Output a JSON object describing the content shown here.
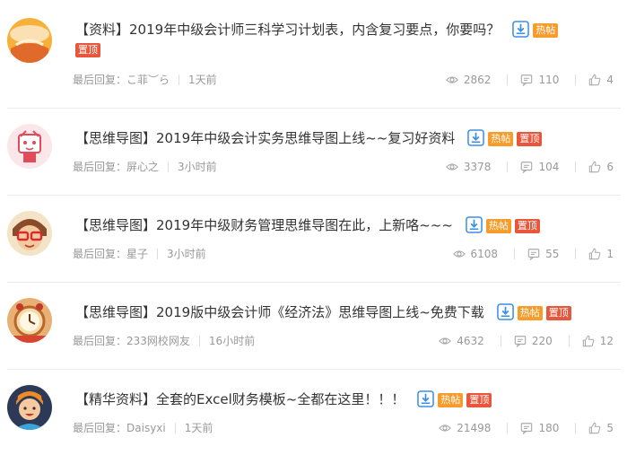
{
  "posts": [
    {
      "category": "【资料】",
      "title": "2019年中级会计师三科学习计划表，内含复习要点，你要吗？",
      "hot_label": "热帖",
      "top_label": "置顶",
      "last_reply_label": "最后回复：",
      "last_reply_user": "こ菲︶ら",
      "time": "1天前",
      "views": "2862",
      "comments": "110",
      "likes": "4"
    },
    {
      "category": "【思维导图】",
      "title": "2019年中级会计实务思维导图上线~~复习好资料",
      "hot_label": "热帖",
      "top_label": "置顶",
      "last_reply_label": "最后回复：",
      "last_reply_user": "屏心之",
      "time": "3小时前",
      "views": "3378",
      "comments": "104",
      "likes": "6"
    },
    {
      "category": "【思维导图】",
      "title": "2019年中级财务管理思维导图在此，上新咯~~~",
      "hot_label": "热帖",
      "top_label": "置顶",
      "last_reply_label": "最后回复：",
      "last_reply_user": "星子",
      "time": "3小时前",
      "views": "6108",
      "comments": "55",
      "likes": "1"
    },
    {
      "category": "【思维导图】",
      "title": "2019版中级会计师《经济法》思维导图上线~免费下载",
      "hot_label": "热帖",
      "top_label": "置顶",
      "last_reply_label": "最后回复：",
      "last_reply_user": "233网校网友",
      "time": "16小时前",
      "views": "4632",
      "comments": "220",
      "likes": "12"
    },
    {
      "category": "【精华资料】",
      "title": "全套的Excel财务模板~全都在这里！！！",
      "hot_label": "热帖",
      "top_label": "置顶",
      "last_reply_label": "最后回复：",
      "last_reply_user": "Daisyxi",
      "time": "1天前",
      "views": "21498",
      "comments": "180",
      "likes": "5"
    }
  ],
  "colors": {
    "hot_tag": "#f79b2b",
    "top_tag": "#e8573b",
    "download_icon": "#3a8ee6",
    "meta_text": "#999999"
  },
  "icons": {
    "download": "download-icon",
    "views": "eye-icon",
    "comments": "comment-icon",
    "likes": "thumbs-up-icon"
  }
}
